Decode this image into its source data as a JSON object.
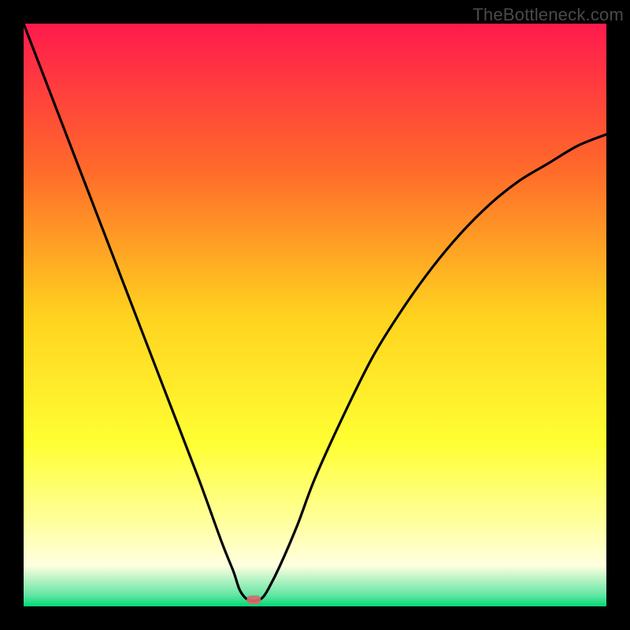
{
  "watermark": "TheBottleneck.com",
  "chart_data": {
    "type": "line",
    "title": "",
    "xlabel": "",
    "ylabel": "",
    "xlim": [
      0,
      100
    ],
    "ylim": [
      0,
      100
    ],
    "background_gradient": {
      "stops": [
        {
          "offset": 0.0,
          "color": "#ff1a4d"
        },
        {
          "offset": 0.25,
          "color": "#ff6a2a"
        },
        {
          "offset": 0.5,
          "color": "#ffd21f"
        },
        {
          "offset": 0.72,
          "color": "#ffff33"
        },
        {
          "offset": 0.85,
          "color": "#ffff99"
        },
        {
          "offset": 0.93,
          "color": "#ffffe0"
        },
        {
          "offset": 0.98,
          "color": "#66e6a6"
        },
        {
          "offset": 1.0,
          "color": "#00d973"
        }
      ]
    },
    "marker": {
      "x": 39.5,
      "y": 1.2,
      "color": "#d86b6b"
    },
    "series": [
      {
        "name": "bottleneck-curve",
        "x": [
          0,
          5,
          10,
          15,
          20,
          25,
          30,
          34,
          36,
          37,
          38,
          39,
          40,
          41,
          42,
          44,
          47,
          50,
          55,
          60,
          65,
          70,
          75,
          80,
          85,
          90,
          95,
          100
        ],
        "values": [
          100,
          87,
          74,
          61,
          48,
          35,
          22,
          11,
          6,
          3,
          1.5,
          1,
          1,
          1.5,
          3,
          7,
          14,
          22,
          33,
          43,
          51,
          58,
          64,
          69,
          73,
          76,
          79,
          81
        ]
      }
    ]
  }
}
